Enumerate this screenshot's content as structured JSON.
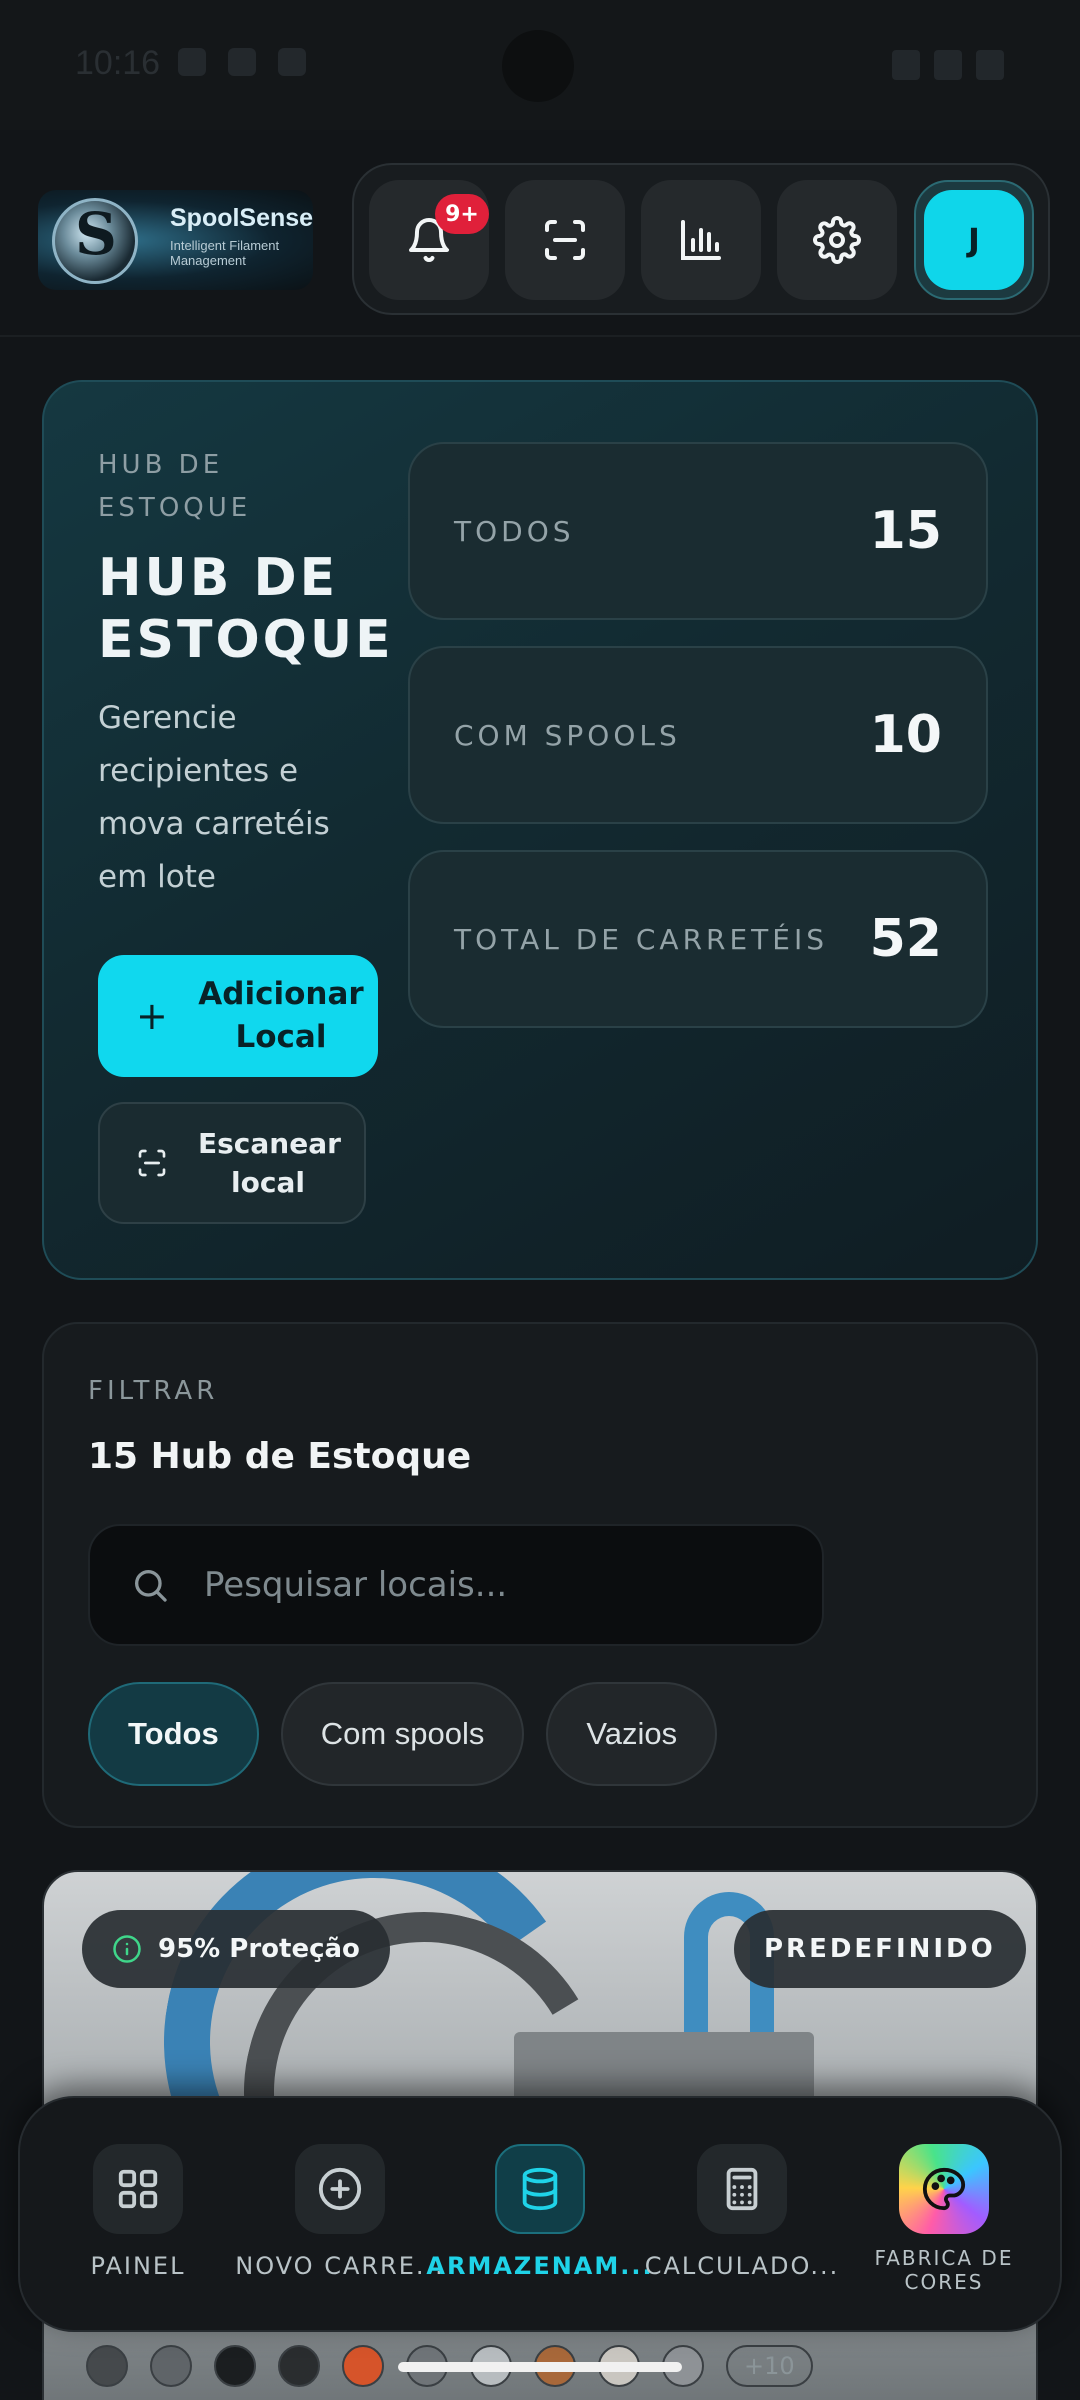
{
  "status_bar": {
    "time": "10:16"
  },
  "header": {
    "logo": {
      "name": "SpoolSense",
      "tagline": "Intelligent Filament Management"
    },
    "notification_badge": "9+",
    "avatar_initial": "J"
  },
  "hub": {
    "eyebrow": "HUB DE ESTOQUE",
    "title": "HUB DE ESTOQUE",
    "description": "Gerencie recipientes e mova carretéis em lote",
    "add_button": "Adicionar Local",
    "scan_button": "Escanear local",
    "stats": [
      {
        "label": "TODOS",
        "value": "15"
      },
      {
        "label": "COM SPOOLS",
        "value": "10"
      },
      {
        "label": "TOTAL DE CARRETÉIS",
        "value": "52"
      }
    ]
  },
  "filter": {
    "eyebrow": "FILTRAR",
    "title": "15 Hub de Estoque",
    "search_placeholder": "Pesquisar locais...",
    "chips": [
      "Todos",
      "Com spools",
      "Vazios"
    ],
    "active_chip": "Todos"
  },
  "location_card": {
    "protection": "95% Proteção",
    "preset": "PREDEFINIDO",
    "more_colors": "+10",
    "color_swatches": [
      "#45494c",
      "#5f6468",
      "#1b1e20",
      "#2a2d2f",
      "#d6542a",
      "#6f7478",
      "#b7bcbf",
      "#a8683a",
      "#c9c6c0",
      "#8e9296"
    ]
  },
  "bottom_nav": {
    "items": [
      {
        "label": "PAINEL",
        "icon": "grid-icon"
      },
      {
        "label": "NOVO CARRE...",
        "icon": "plus-circle-icon"
      },
      {
        "label": "ARMAZENAM...",
        "icon": "database-icon",
        "active": true
      },
      {
        "label": "CALCULADO...",
        "icon": "calculator-icon"
      },
      {
        "label": "FABRICA DE CORES",
        "icon": "palette-icon"
      }
    ]
  },
  "colors": {
    "accent": "#10d8ee",
    "badge": "#e0203a",
    "background": "#121518"
  }
}
